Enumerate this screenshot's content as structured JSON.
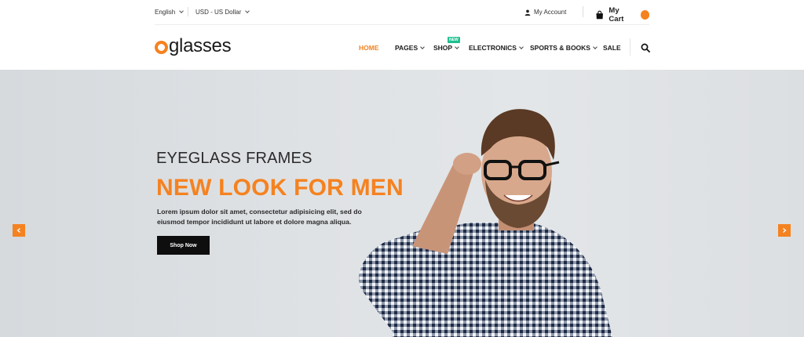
{
  "topbar": {
    "language": "English",
    "currency": "USD - US Dollar",
    "account": "My Account",
    "cart": "My Cart"
  },
  "header": {
    "logo_text": "glasses",
    "nav": [
      {
        "label": "HOME",
        "active": true
      },
      {
        "label": "PAGES"
      },
      {
        "label": "SHOP",
        "badge": "NEW"
      },
      {
        "label": "ELECTRONICS"
      },
      {
        "label": "SPORTS & BOOKS"
      },
      {
        "label": "SALE"
      }
    ]
  },
  "hero": {
    "subtitle": "EYEGLASS FRAMES",
    "title": "NEW LOOK FOR MEN",
    "text_line1": "Lorem ipsum dolor sit amet, consectetur adipisicing elit, sed do",
    "text_line2": "eiusmod tempor incididunt ut labore et dolore magna aliqua.",
    "button": "Shop Now"
  },
  "colors": {
    "accent": "#f58220",
    "badge_new": "#1fbf8f",
    "button_bg": "#0e0e0e"
  },
  "icons": {
    "account": "user-icon",
    "cart": "shopping-bag-icon",
    "search": "search-icon",
    "prev": "chevron-left-icon",
    "next": "chevron-right-icon"
  }
}
